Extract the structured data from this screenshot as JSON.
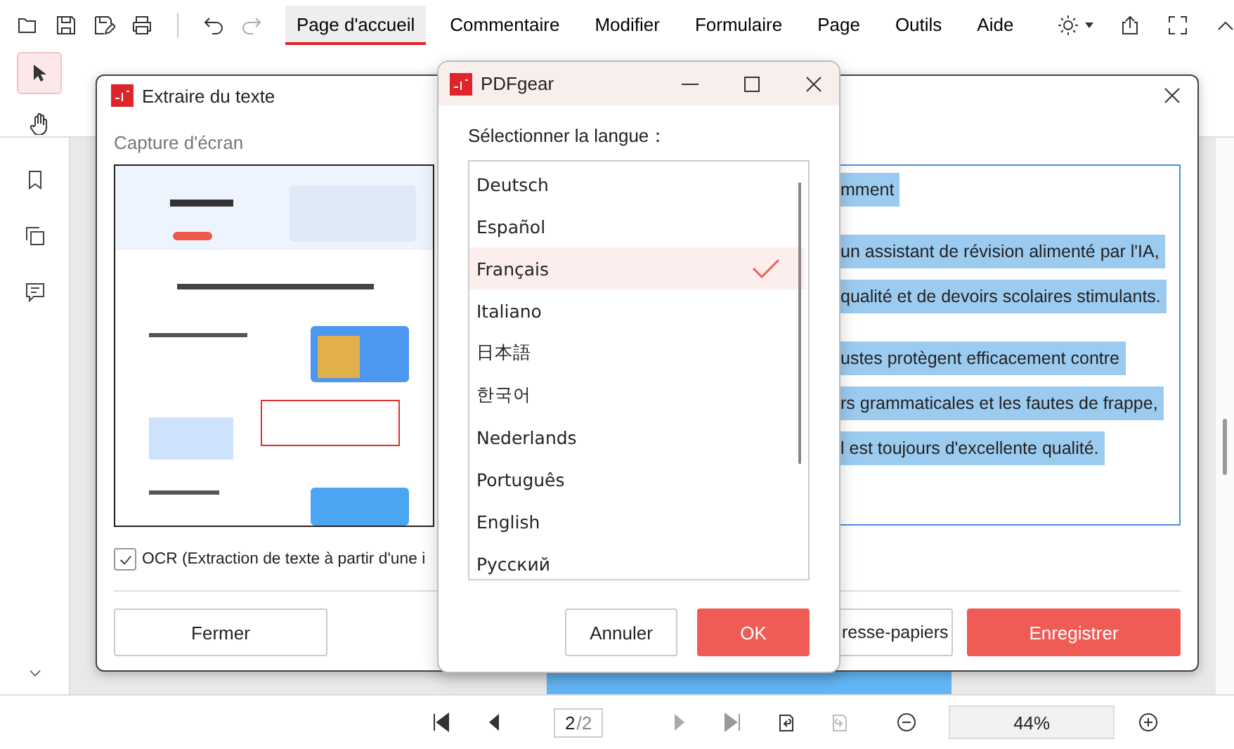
{
  "menu_tabs": [
    {
      "label": "Page d'accueil",
      "selected": true
    },
    {
      "label": "Commentaire",
      "selected": false
    },
    {
      "label": "Modifier",
      "selected": false
    },
    {
      "label": "Formulaire",
      "selected": false
    },
    {
      "label": "Page",
      "selected": false
    },
    {
      "label": "Outils",
      "selected": false
    },
    {
      "label": "Aide",
      "selected": false
    }
  ],
  "extract_dialog": {
    "title": "Extraire du texte",
    "section_label": "Capture d'écran",
    "ocr": {
      "label": "OCR (Extraction de texte à partir d'une i",
      "checked": true
    },
    "paragraphs": [
      [
        "mment"
      ],
      [
        "un assistant de révision alimenté par l'IA,",
        "qualité et de devoirs scolaires stimulants."
      ],
      [
        "ustes protègent efficacement contre",
        "rs grammaticales et les fautes de frappe,",
        "l est toujours d'excellente qualité."
      ]
    ],
    "buttons": [
      {
        "label": "Fermer",
        "kind": "plain"
      },
      {
        "label": "resse-papiers",
        "kind": "plain"
      },
      {
        "label": "Enregistrer",
        "kind": "primary"
      }
    ]
  },
  "language_dialog": {
    "title": "PDFgear",
    "prompt": "Sélectionner la langue：",
    "languages": [
      {
        "label": "Deutsch",
        "selected": false
      },
      {
        "label": "Español",
        "selected": false
      },
      {
        "label": "Français",
        "selected": true
      },
      {
        "label": "Italiano",
        "selected": false
      },
      {
        "label": "日本語",
        "selected": false
      },
      {
        "label": "한국어",
        "selected": false
      },
      {
        "label": "Nederlands",
        "selected": false
      },
      {
        "label": "Português",
        "selected": false
      },
      {
        "label": "English",
        "selected": false
      },
      {
        "label": "Русский",
        "selected": false
      }
    ],
    "buttons": [
      {
        "label": "Annuler",
        "kind": "plain"
      },
      {
        "label": "OK",
        "kind": "primary"
      }
    ]
  },
  "status_bar": {
    "page": "2",
    "page_total": "/2",
    "zoom": "44%"
  }
}
